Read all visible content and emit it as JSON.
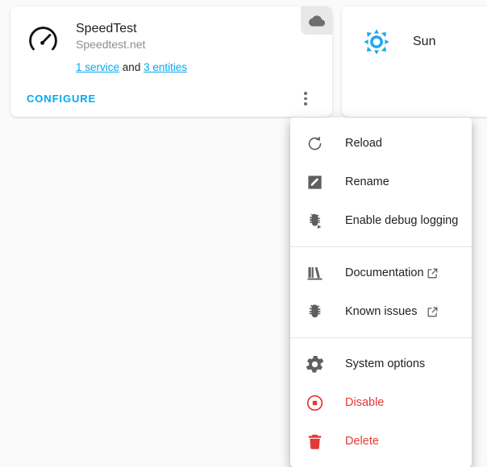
{
  "integration_card": {
    "icon": "speedometer-icon",
    "title": "SpeedTest",
    "subtitle": "Speedtest.net",
    "links_prefix": "",
    "service_link": "1 service",
    "conjunction": "and",
    "entities_link": "3 entities",
    "configure_label": "CONFIGURE",
    "cloud_badge_icon": "cloud-icon",
    "overflow_icon": "dots-vertical-icon"
  },
  "sun_card": {
    "icon": "sun-icon",
    "title": "Sun"
  },
  "menu": {
    "groups": [
      {
        "items": [
          {
            "label": "Reload",
            "icon": "reload-icon",
            "external": false,
            "danger": false
          },
          {
            "label": "Rename",
            "icon": "rename-box-icon",
            "external": false,
            "danger": false
          },
          {
            "label": "Enable debug logging",
            "icon": "bug-play-icon",
            "external": false,
            "danger": false
          }
        ]
      },
      {
        "items": [
          {
            "label": "Documentation",
            "icon": "bookshelf-icon",
            "external": true,
            "danger": false
          },
          {
            "label": "Known issues",
            "icon": "bug-icon",
            "external": true,
            "danger": false
          }
        ]
      },
      {
        "items": [
          {
            "label": "System options",
            "icon": "cog-icon",
            "external": false,
            "danger": false
          },
          {
            "label": "Disable",
            "icon": "stop-circle-icon",
            "external": false,
            "danger": true
          },
          {
            "label": "Delete",
            "icon": "trash-icon",
            "external": false,
            "danger": true
          }
        ]
      }
    ]
  },
  "colors": {
    "accent": "#03a9f4",
    "danger": "#e53935",
    "text": "#212121",
    "muted": "#8e8e8e",
    "icon": "#5f5f5f",
    "background": "#fafafa",
    "card": "#ffffff"
  }
}
